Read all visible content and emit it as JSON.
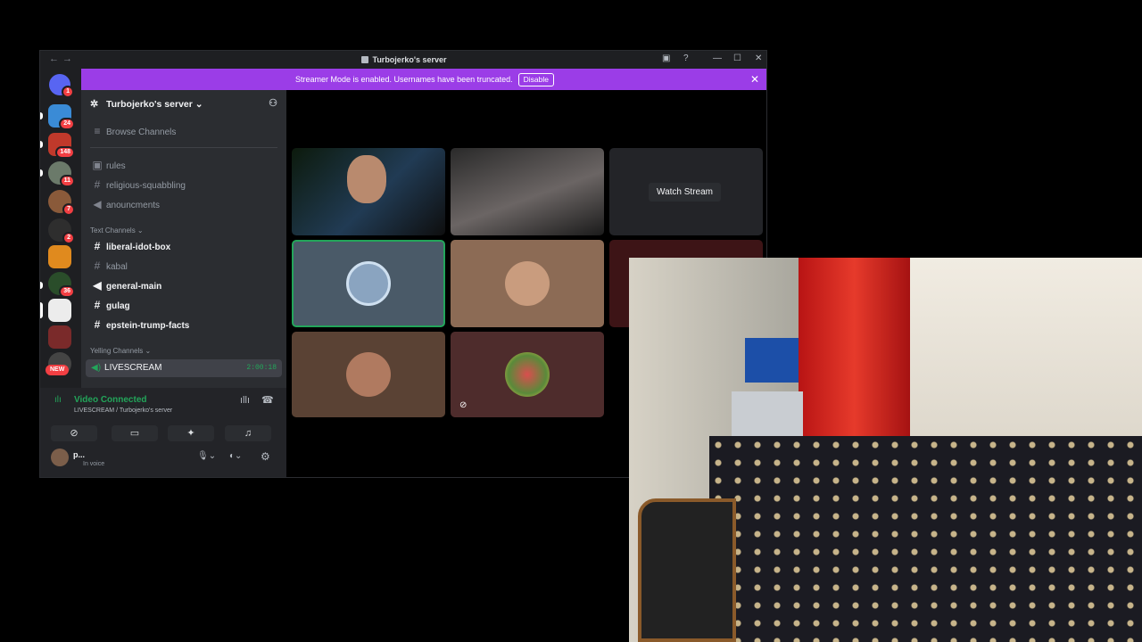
{
  "titlebar": {
    "title": "Turbojerko's server",
    "nav_back": "←",
    "nav_forward": "→",
    "minimize": "—",
    "maximize": "☐",
    "close": "✕"
  },
  "banner": {
    "text": "Streamer Mode is enabled. Usernames have been truncated.",
    "button": "Disable",
    "close": "✕"
  },
  "guilds": {
    "badges": [
      "1",
      "24",
      "148",
      "11",
      "7",
      "2",
      "36"
    ],
    "new_label": "NEW"
  },
  "server": {
    "name": "Turbojerko's server ⌄",
    "browse": "Browse Channels",
    "top_channels": [
      "rules",
      "religious-squabbling",
      "anouncments"
    ],
    "text_category": "Text Channels ⌄",
    "text_channels": [
      "liberal-idot-box",
      "kabal",
      "general-main",
      "gulag",
      "epstein-trump-facts"
    ],
    "voice_category": "Yelling Channels ⌄",
    "voice_channel": "LIVESCREAM",
    "voice_time": "2:00:18"
  },
  "voice": {
    "status": "Video Connected",
    "sub": "LIVESCREAM / Turbojerko's server",
    "user_name": "p...",
    "user_status": "In voice"
  },
  "stage": {
    "watch_stream": "Watch Stream"
  },
  "colors": {
    "accent": "#9b3de7",
    "green": "#23a55a",
    "badge": "#f23f43"
  }
}
